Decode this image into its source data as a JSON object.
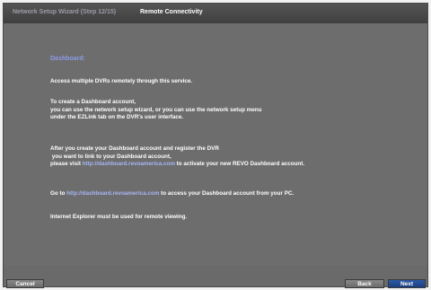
{
  "header": {
    "step_label": "Network Setup Wizard (Step 12/15)",
    "title": "Remote Connectivity"
  },
  "content": {
    "heading": "Dashboard:",
    "p1": "Access multiple DVRs remotely through this service.",
    "p2": [
      "To create a Dashboard account,",
      "you can use the network setup wizard, or you can use the network setup menu",
      "under the EZLink tab on the DVR's user interface."
    ],
    "p3": {
      "line1": "After you create your Dashboard account and register the DVR",
      "line2": " you want to link to your Dashboard account,",
      "line3_pre": "please visit ",
      "line3_link": "http://dashboard.revoamerica.com",
      "line3_post": " to activate your new REVO Dashboard account."
    },
    "p4": {
      "pre": "Go to ",
      "link": "http://dashboard.revoamerica.com",
      "post": " to access your Dashboard account from your PC."
    },
    "p5": "Internet Explorer must be used for remote viewing."
  },
  "footer": {
    "cancel_label": "Cancel",
    "back_label": "Back",
    "next_label": "Next"
  },
  "colors": {
    "link": "#a7b6f5",
    "heading": "#8c9be8",
    "next_button": "#1c3f80"
  }
}
